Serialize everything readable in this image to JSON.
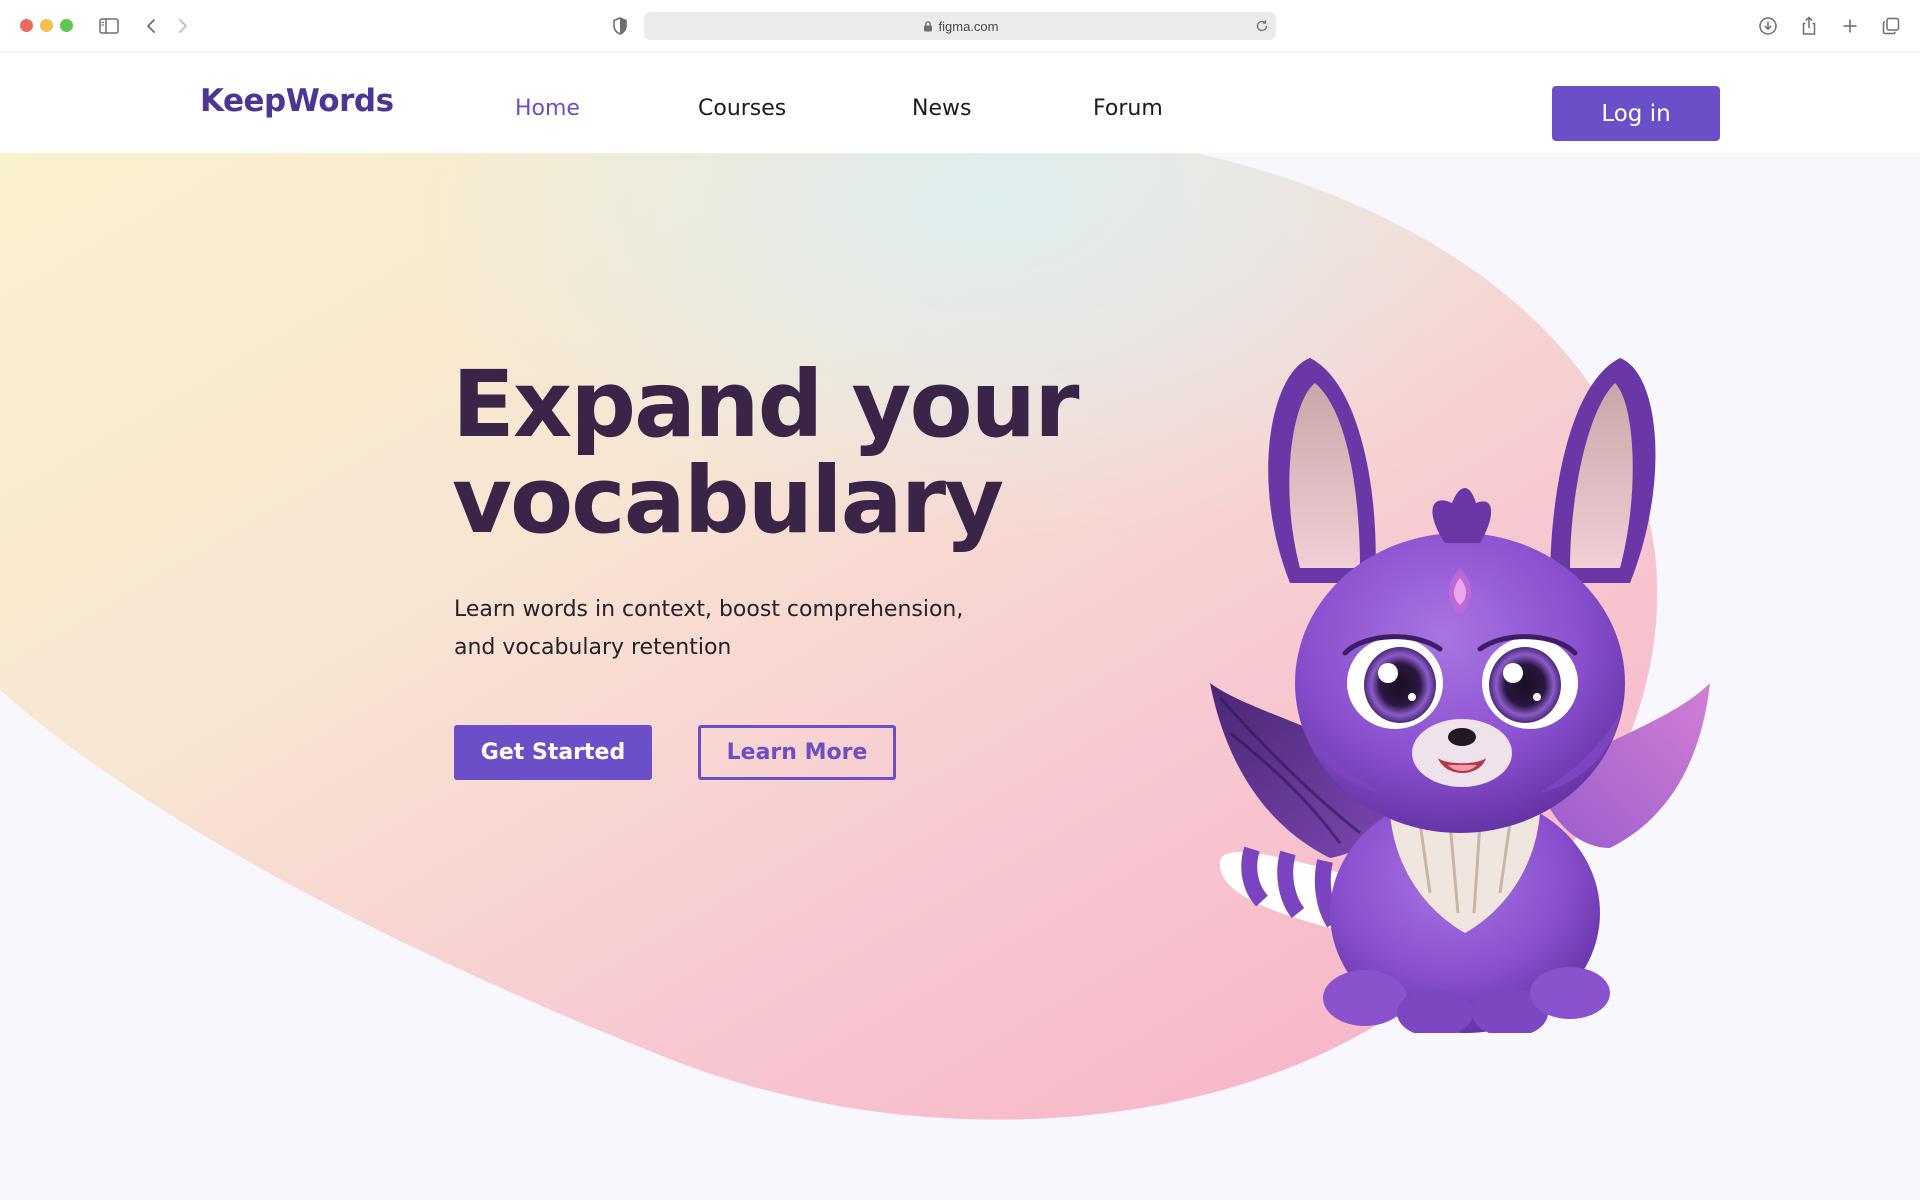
{
  "browser": {
    "url": "figma.com"
  },
  "header": {
    "logo": "KeepWords",
    "nav": [
      {
        "label": "Home",
        "active": true
      },
      {
        "label": "Courses",
        "active": false
      },
      {
        "label": "News",
        "active": false
      },
      {
        "label": "Forum",
        "active": false
      }
    ],
    "login_label": "Log in"
  },
  "hero": {
    "title_line1": "Expand your",
    "title_line2": "vocabulary",
    "subtitle_line1": "Learn words in context, boost comprehension,",
    "subtitle_line2": "and vocabulary retention",
    "primary_button": "Get Started",
    "secondary_button": "Learn More",
    "illustration": "purple-winged-fox-mascot"
  },
  "colors": {
    "brand": "#6b4fc8",
    "logo": "#4a3694",
    "heading": "#3a2448",
    "blob_warm": "#f9efcc",
    "blob_pink": "#f8b3c8"
  }
}
